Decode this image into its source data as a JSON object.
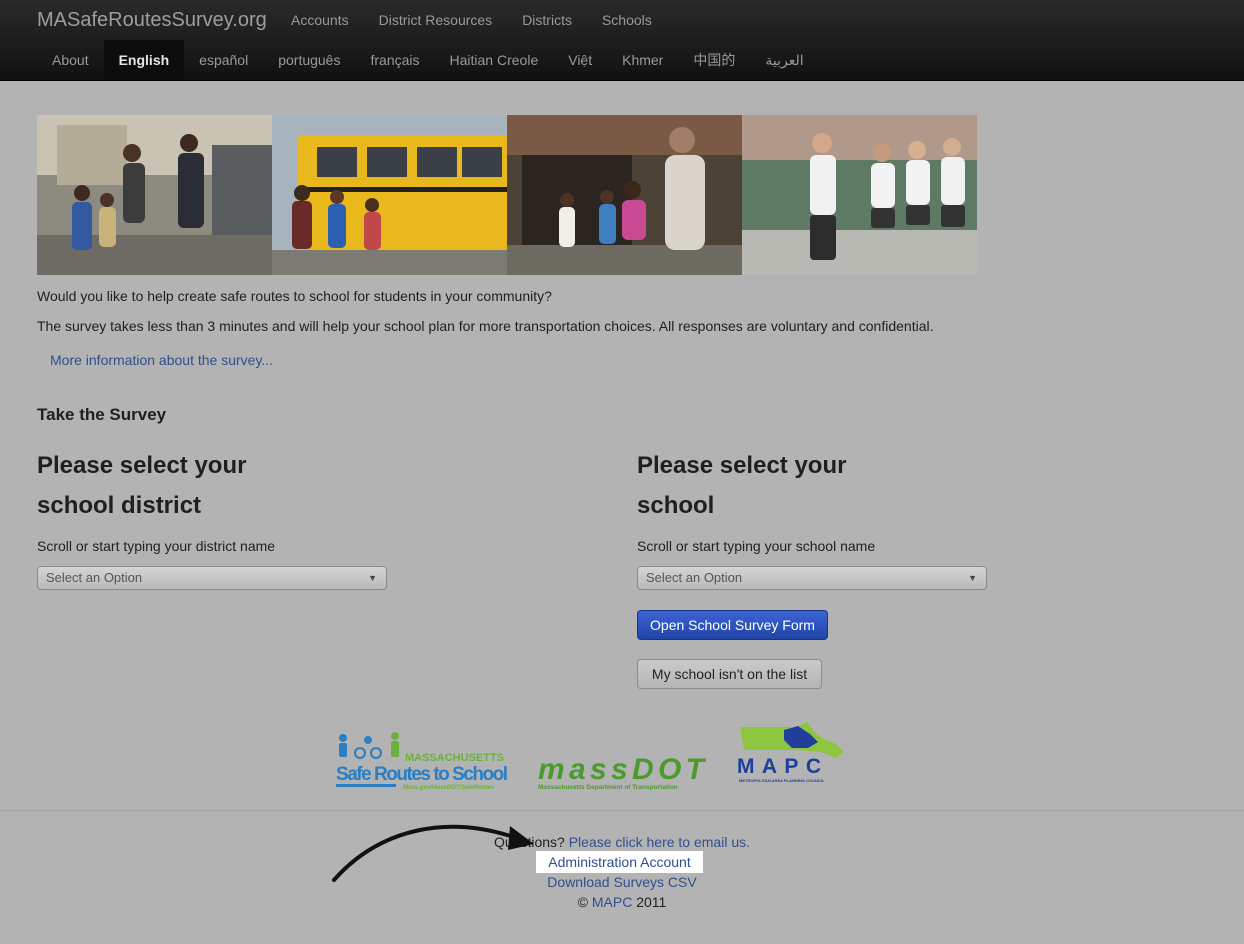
{
  "nav": {
    "brand": "MASafeRoutesSurvey.org",
    "top_items": [
      "Accounts",
      "District Resources",
      "Districts",
      "Schools"
    ],
    "languages": [
      "About",
      "English",
      "español",
      "português",
      "français",
      "Haitian Creole",
      "Việt",
      "Khmer",
      "中国的",
      "العربية"
    ],
    "active_language": "English"
  },
  "intro": {
    "question": "Would you like to help create safe routes to school for students in your community?",
    "description": "The survey takes less than 3 minutes and will help your school plan for more transportation choices. All responses are voluntary and confidential.",
    "more_link": "More information about the survey..."
  },
  "survey": {
    "section_title": "Take the Survey",
    "district": {
      "title_line1": "Please select your",
      "title_line2": "school district",
      "hint": "Scroll or start typing your district name",
      "select_placeholder": "Select an Option"
    },
    "school": {
      "title_line1": "Please select your",
      "title_line2": "school",
      "hint": "Scroll or start typing your school name",
      "select_placeholder": "Select an Option",
      "open_button": "Open School Survey Form",
      "missing_button": "My school isn't on the list"
    }
  },
  "logos": {
    "srts_top": "MASSACHUSETTS",
    "srts_main": "Safe Routes to School",
    "srts_url": "Mass.gov/MassDOT/SafeRoutes",
    "massdot_main": "massDOT",
    "massdot_sub": "Massachusetts Department of Transportation",
    "mapc_main": "MAPC",
    "mapc_sub": "METROPOLITAN AREA PLANNING COUNCIL"
  },
  "footer": {
    "questions_text": "Questions? ",
    "email_link": "Please click here to email us.",
    "admin_link": "Administration Account",
    "download_link": "Download Surveys CSV",
    "copyright_symbol": "© ",
    "mapc_link": "MAPC",
    "year": " 2011"
  },
  "colors": {
    "background": "#b3b3b3",
    "navbar": "#1a1a1a",
    "link": "#2f4f8f",
    "primary_button": "#2c50b8",
    "srts_blue": "#2a7fc4",
    "srts_green": "#6bb23c",
    "massdot_green": "#4a9a2e",
    "massdot_blue": "#1e5fa8",
    "mapc_green": "#8cc63f",
    "mapc_blue": "#1f3f9a"
  }
}
